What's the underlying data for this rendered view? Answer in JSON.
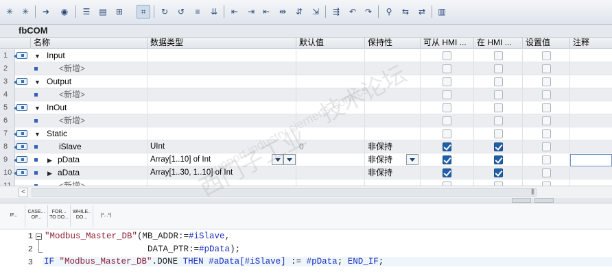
{
  "toolbar": {
    "icons": [
      "insert-row-icon",
      "add-row-icon",
      "jump-icon",
      "monitor-icon",
      "properties-icon",
      "block-interface-icon",
      "compile-icon",
      "snapshot-icon",
      "reset-icon",
      "format-icon",
      "download-icon",
      "indent-icon",
      "outdent-icon",
      "comment-icon",
      "uncomment-icon",
      "columns-icon",
      "structure-icon",
      "breakpoint-icon",
      "step-icon",
      "run-icon",
      "watch-icon",
      "goto-icon",
      "compare-icon",
      "online-icon"
    ]
  },
  "block": {
    "name": "fbCOM"
  },
  "table": {
    "headers": {
      "name": "名称",
      "datatype": "数据类型",
      "default": "默认值",
      "retain": "保持性",
      "hmi_access": "可从 HMI ...",
      "hmi_visible": "在 HMI ...",
      "setpoint": "设置值",
      "comment": "注释"
    },
    "rows": [
      {
        "num": "1",
        "name": "Input",
        "type": "",
        "default": "",
        "retain": ""
      },
      {
        "num": "2",
        "name": "<新增>",
        "type": "",
        "default": "",
        "retain": ""
      },
      {
        "num": "3",
        "name": "Output",
        "type": "",
        "default": "",
        "retain": ""
      },
      {
        "num": "4",
        "name": "<新增>",
        "type": "",
        "default": "",
        "retain": ""
      },
      {
        "num": "5",
        "name": "InOut",
        "type": "",
        "default": "",
        "retain": ""
      },
      {
        "num": "6",
        "name": "<新增>",
        "type": "",
        "default": "",
        "retain": ""
      },
      {
        "num": "7",
        "name": "Static",
        "type": "",
        "default": "",
        "retain": ""
      },
      {
        "num": "8",
        "name": "iSlave",
        "type": "UInt",
        "default": "0",
        "retain": "非保持"
      },
      {
        "num": "9",
        "name": "pData",
        "type": "Array[1..10] of Int",
        "default": "",
        "retain": "非保持"
      },
      {
        "num": "10",
        "name": "aData",
        "type": "Array[1..30, 1..10] of Int",
        "default": "",
        "retain": "非保持"
      },
      {
        "num": "11",
        "name": "<新增>",
        "type": "",
        "default": "",
        "retain": ""
      }
    ]
  },
  "scl_buttons": [
    {
      "l1": "IF...",
      "l2": ""
    },
    {
      "l1": "CASE...",
      "l2": "OF..."
    },
    {
      "l1": "FOR...",
      "l2": "TO DO..."
    },
    {
      "l1": "WHILE..",
      "l2": "DO..."
    },
    {
      "l1": "(*...*)",
      "l2": ""
    }
  ],
  "code": {
    "line_numbers": [
      "1",
      "2",
      "3"
    ],
    "line1_str": "\"Modbus_Master_DB\"",
    "line1_rest": "(MB_ADDR:=",
    "line1_var": "#iSlave",
    "line1_end": ",",
    "line2_pad": "                    DATA_PTR:=",
    "line2_var": "#pData",
    "line2_end": ");",
    "line3_if": "IF",
    "line3_str": "\"Modbus_Master_DB\"",
    "line3_done": ".DONE",
    "line3_then": "THEN",
    "line3_var1": "#aData[#iSlave]",
    "line3_assign": " := ",
    "line3_var2": "#pData",
    "line3_semi": ";",
    "line3_end": "END_IF",
    "line3_final": ";"
  },
  "watermark": {
    "text1": "西门子工业",
    "text2": "技术论坛",
    "text3": "support.industry.siemens.com/cs"
  }
}
